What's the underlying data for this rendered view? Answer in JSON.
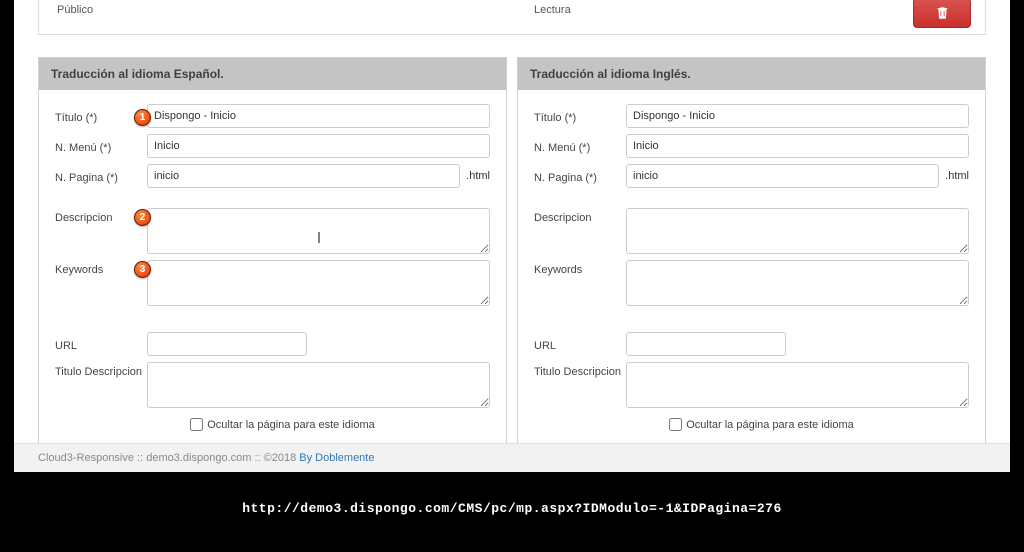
{
  "topRow": {
    "leftLabel": "Público",
    "midLabel": "Lectura"
  },
  "panels": {
    "es": {
      "header": "Traducción al idioma Español.",
      "titleLabel": "Título (*)",
      "menuLabel": "N. Menú (*)",
      "pageLabel": "N. Pagina (*)",
      "descLabel": "Descripcion",
      "keywordsLabel": "Keywords",
      "urlLabel": "URL",
      "titleDescLabel": "Titulo Descripcion",
      "hideLabel": "Ocultar la página para este idioma",
      "htmlSuffix": ".html",
      "titleValue": "Dispongo - Inicio",
      "menuValue": "Inicio",
      "pageValue": "inicio",
      "descValue": "",
      "keywordsValue": "",
      "urlValue": "",
      "titleDescValue": ""
    },
    "en": {
      "header": "Traducción al idioma Inglés.",
      "titleLabel": "Título (*)",
      "menuLabel": "N. Menú (*)",
      "pageLabel": "N. Pagina (*)",
      "descLabel": "Descripcion",
      "keywordsLabel": "Keywords",
      "urlLabel": "URL",
      "titleDescLabel": "Titulo Descripcion",
      "hideLabel": "Ocultar la página para este idioma",
      "htmlSuffix": ".html",
      "titleValue": "Dispongo - Inicio",
      "menuValue": "Inicio",
      "pageValue": "inicio",
      "descValue": "",
      "keywordsValue": "",
      "urlValue": "",
      "titleDescValue": ""
    }
  },
  "badges": {
    "b1": "1",
    "b2": "2",
    "b3": "3"
  },
  "footer": {
    "prefix": "Cloud3-Responsive :: demo3.dispongo.com :: ©2018 ",
    "link": "By Doblemente"
  },
  "bottomUrl": "http://demo3.dispongo.com/CMS/pc/mp.aspx?IDModulo=-1&IDPagina=276"
}
